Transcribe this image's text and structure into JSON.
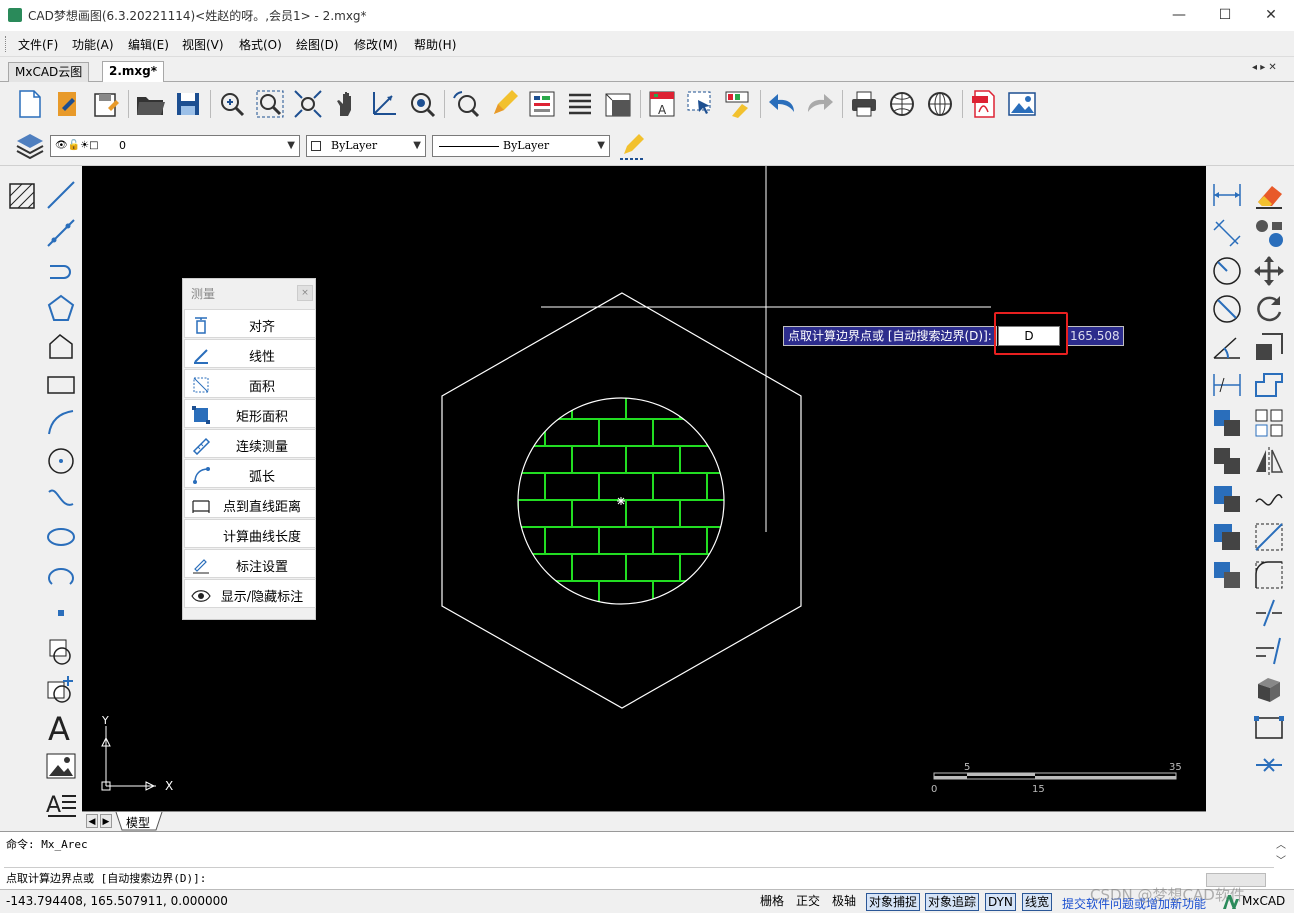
{
  "window": {
    "title": "CAD梦想画图(6.3.20221114)<姓赵的呀。,会员1> - 2.mxg*",
    "minimize": "—",
    "maximize": "☐",
    "close": "✕"
  },
  "menu": [
    "文件(F)",
    "功能(A)",
    "编辑(E)",
    "视图(V)",
    "格式(O)",
    "绘图(D)",
    "修改(M)",
    "帮助(H)"
  ],
  "doc_tabs": [
    {
      "label": "MxCAD云图",
      "active": false
    },
    {
      "label": "2.mxg*",
      "active": true
    }
  ],
  "tab_nav": "◂ ▸ ✕",
  "layer_combo": "0",
  "color_combo": "ByLayer",
  "linetype_combo": "ByLayer",
  "measure_panel": {
    "title": "测量",
    "close": "×",
    "items": [
      "对齐",
      "线性",
      "面积",
      "矩形面积",
      "连续测量",
      "弧长",
      "点到直线距离",
      "计算曲线长度",
      "标注设置",
      "显示/隐藏标注"
    ]
  },
  "dyn_prompt": {
    "prompt": "点取计算边界点或 [自动搜索边界(D)]:",
    "input_value": "D",
    "coord_value": "165.508"
  },
  "ucs": {
    "x_label": "X",
    "y_label": "Y"
  },
  "scale_bar": {
    "labels_top": [
      "5",
      "35"
    ],
    "labels_bottom": [
      "0",
      "15"
    ]
  },
  "model_tab": "模型",
  "command_lines": [
    "命令: Mx_Arec",
    "点取计算边界点或 [自动搜索边界(D)]:"
  ],
  "status": {
    "coords": "-143.794408,  165.507911,  0.000000",
    "toggles": [
      {
        "label": "栅格",
        "on": false
      },
      {
        "label": "正交",
        "on": false
      },
      {
        "label": "极轴",
        "on": false
      },
      {
        "label": "对象捕捉",
        "on": true
      },
      {
        "label": "对象追踪",
        "on": true
      },
      {
        "label": "DYN",
        "on": true
      },
      {
        "label": "线宽",
        "on": true
      }
    ],
    "feedback_link": "提交软件问题或增加新功能",
    "brand": "MxCAD",
    "watermark": "CSDN @梦想CAD软件"
  },
  "colors": {
    "canvas": "#000000",
    "hatch": "#22dd22",
    "prompt_bg": "#2c2c8c",
    "highlight_box": "#e82020"
  }
}
